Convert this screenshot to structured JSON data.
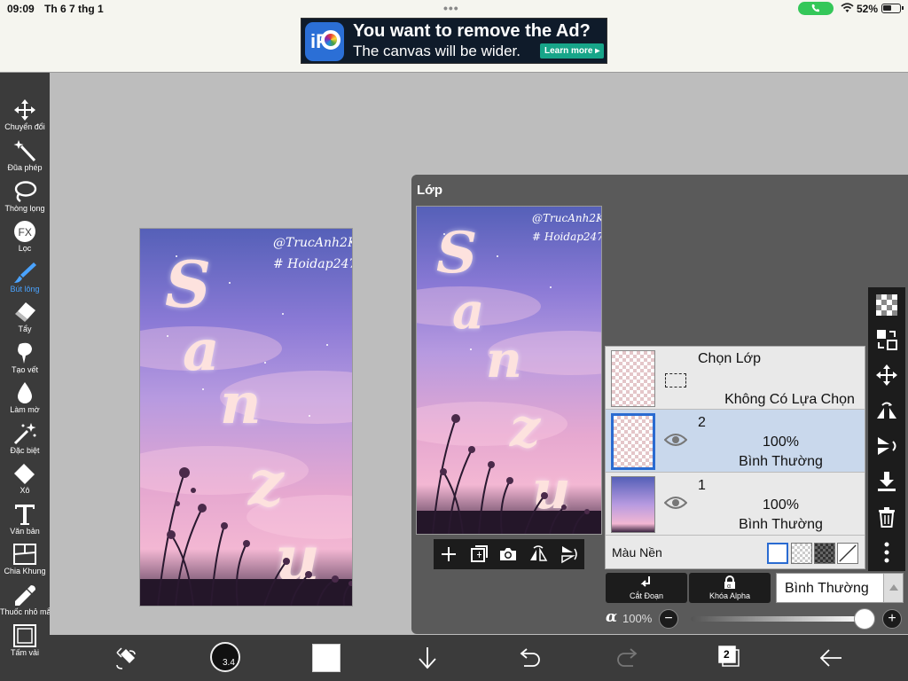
{
  "status_bar": {
    "time": "09:09",
    "date": "Th 6 7 thg 1",
    "battery": "52%"
  },
  "ad": {
    "logo_text": "iP",
    "headline": "You want to remove the Ad?",
    "subline": "The canvas will be wider.",
    "cta": "Learn more ▸"
  },
  "toolbar": {
    "items": [
      {
        "label": "Chuyển đổi",
        "icon": "move-arrows-icon"
      },
      {
        "label": "Đũa phép",
        "icon": "magic-wand-icon"
      },
      {
        "label": "Thòng lọng",
        "icon": "lasso-icon"
      },
      {
        "label": "Lọc",
        "icon": "fx-icon"
      },
      {
        "label": "Bút lông",
        "icon": "brush-icon",
        "active": true
      },
      {
        "label": "Tẩy",
        "icon": "eraser-icon"
      },
      {
        "label": "Tạo vết",
        "icon": "smudge-icon"
      },
      {
        "label": "Làm mờ",
        "icon": "blur-drop-icon"
      },
      {
        "label": "Đặc biệt",
        "icon": "special-brush-icon"
      },
      {
        "label": "Xô",
        "icon": "bucket-icon"
      },
      {
        "label": "Văn bản",
        "icon": "text-icon"
      },
      {
        "label": "Chia Khung",
        "icon": "frame-divider-icon"
      },
      {
        "label": "Thuốc nhỏ mắt",
        "icon": "eyedropper-icon"
      },
      {
        "label": "Tấm vải",
        "icon": "canvas-icon"
      }
    ],
    "active_color": "#4aa3ff"
  },
  "artwork": {
    "handle_1": "@TrucAnh2K10",
    "handle_2": "# Hoidap247",
    "letters": [
      "S",
      "a",
      "n",
      "z",
      "u"
    ]
  },
  "layer_panel": {
    "title": "Lớp",
    "selection_row": {
      "name": "Chọn Lớp",
      "state": "Không Có Lựa Chọn"
    },
    "layers": [
      {
        "number": "2",
        "opacity": "100%",
        "mode": "Bình Thường",
        "selected": true
      },
      {
        "number": "1",
        "opacity": "100%",
        "mode": "Bình Thường",
        "selected": false
      }
    ],
    "background_label": "Màu Nền",
    "cut_label": "Cắt Đoạn",
    "alpha_lock_label": "Khóa Alpha",
    "blend_mode": "Bình Thường",
    "alpha_symbol": "α",
    "opacity_value": "100%",
    "opacity_fraction": 1.0,
    "selected_color": "#2a6bd1"
  },
  "bottom_bar": {
    "brush_size": "3.4",
    "layer_count": "2",
    "current_color": "#ffffff"
  }
}
